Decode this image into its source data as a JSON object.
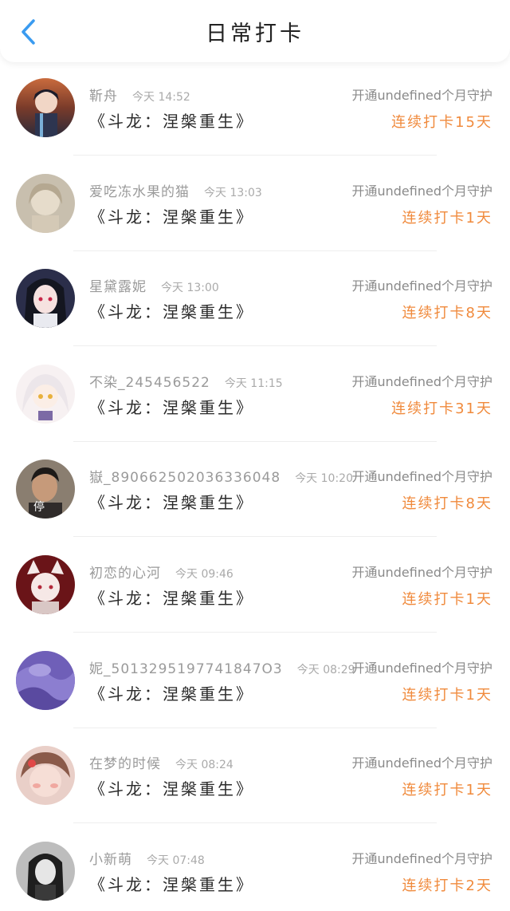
{
  "header": {
    "title": "日常打卡",
    "back_icon": "chevron-left-icon",
    "accent_color": "#3a9bf0"
  },
  "colors": {
    "streak": "#f08a3c",
    "meta": "#9a9a9a"
  },
  "items": [
    {
      "user": "靳舟",
      "time": "今天 14:52",
      "guard": "开通undefined个月守护",
      "book": "《斗龙：涅槃重生》",
      "streak": "连续打卡15天",
      "avatar_icon": "avatar-anime-boy"
    },
    {
      "user": "爱吃冻水果的猫",
      "time": "今天 13:03",
      "guard": "开通undefined个月守护",
      "book": "《斗龙：涅槃重生》",
      "streak": "连续打卡1天",
      "avatar_icon": "avatar-sketch-girl"
    },
    {
      "user": "星黛露妮",
      "time": "今天 13:00",
      "guard": "开通undefined个月守护",
      "book": "《斗龙：涅槃重生》",
      "streak": "连续打卡8天",
      "avatar_icon": "avatar-dark-hair-girl"
    },
    {
      "user": "不染_245456522",
      "time": "今天 11:15",
      "guard": "开通undefined个月守护",
      "book": "《斗龙：涅槃重生》",
      "streak": "连续打卡31天",
      "avatar_icon": "avatar-white-hair-chibi"
    },
    {
      "user": "嶽_890662502036336048",
      "time": "今天 10:20",
      "guard": "开通undefined个月守护",
      "book": "《斗龙：涅槃重生》",
      "streak": "连续打卡8天",
      "avatar_icon": "avatar-photo-man"
    },
    {
      "user": "初恋的心河",
      "time": "今天 09:46",
      "guard": "开通undefined个月守护",
      "book": "《斗龙：涅槃重生》",
      "streak": "连续打卡1天",
      "avatar_icon": "avatar-fox-girl"
    },
    {
      "user": "妮_5013295197741847O3",
      "time": "今天 08:29",
      "guard": "开通undefined个月守护",
      "book": "《斗龙：涅槃重生》",
      "streak": "连续打卡1天",
      "avatar_icon": "avatar-purple-cloth"
    },
    {
      "user": "在梦的时候",
      "time": "今天 08:24",
      "guard": "开通undefined个月守护",
      "book": "《斗龙：涅槃重生》",
      "streak": "连续打卡1天",
      "avatar_icon": "avatar-blush-girl"
    },
    {
      "user": "小新萌",
      "time": "今天 07:48",
      "guard": "开通undefined个月守护",
      "book": "《斗龙：涅槃重生》",
      "streak": "连续打卡2天",
      "avatar_icon": "avatar-bw-girl"
    }
  ]
}
